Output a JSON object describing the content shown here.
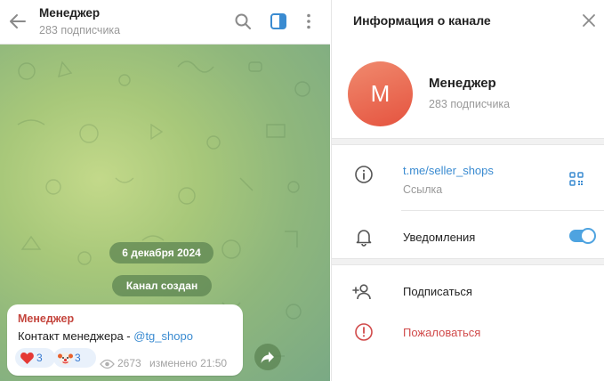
{
  "chat": {
    "title": "Менеджер",
    "subtitle": "283 подписчика",
    "icons": [
      "back-arrow-icon",
      "search-icon",
      "side-panel-icon",
      "more-vertical-icon"
    ],
    "date_pill": "6 декабря 2024",
    "service_pill": "Канал создан",
    "message": {
      "author": "Менеджер",
      "text": "Контакт менеджера  - ",
      "link": "@tg_shopo",
      "reactions": [
        {
          "emoji": "heart-emoji",
          "count": "3"
        },
        {
          "emoji": "clown-emoji",
          "count": "3"
        }
      ],
      "views": "2673",
      "edited": "изменено 21:50"
    }
  },
  "info": {
    "title": "Информация о канале",
    "avatar_letter": "М",
    "name": "Менеджер",
    "subscribers": "283 подписчика",
    "link_value": "t.me/seller_shops",
    "link_label": "Ссылка",
    "notifications_label": "Уведомления",
    "notifications_enabled": true,
    "subscribe_label": "Подписаться",
    "report_label": "Пожаловаться"
  },
  "colors": {
    "accent": "#3a8bd1",
    "author": "#c4453d",
    "danger": "#d14b4b",
    "toggle": "#4ea3e0"
  }
}
